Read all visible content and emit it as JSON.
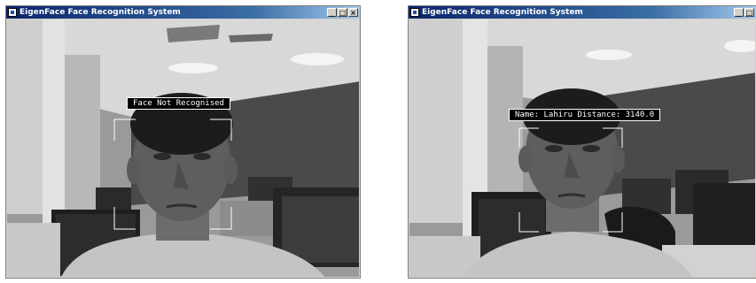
{
  "windows": [
    {
      "title": "EigenFace Face Recognition System",
      "overlay_text": "Face Not Recognised"
    },
    {
      "title": "EigenFace Face Recognition System",
      "overlay_text": "Name: Lahiru Distance: 3140.0"
    }
  ],
  "window_buttons": {
    "minimize": "_",
    "maximize": "□",
    "close": "×"
  },
  "colors": {
    "titlebar_start": "#0a246a",
    "titlebar_end": "#a6caf0",
    "frame": "#d4d0c8"
  }
}
